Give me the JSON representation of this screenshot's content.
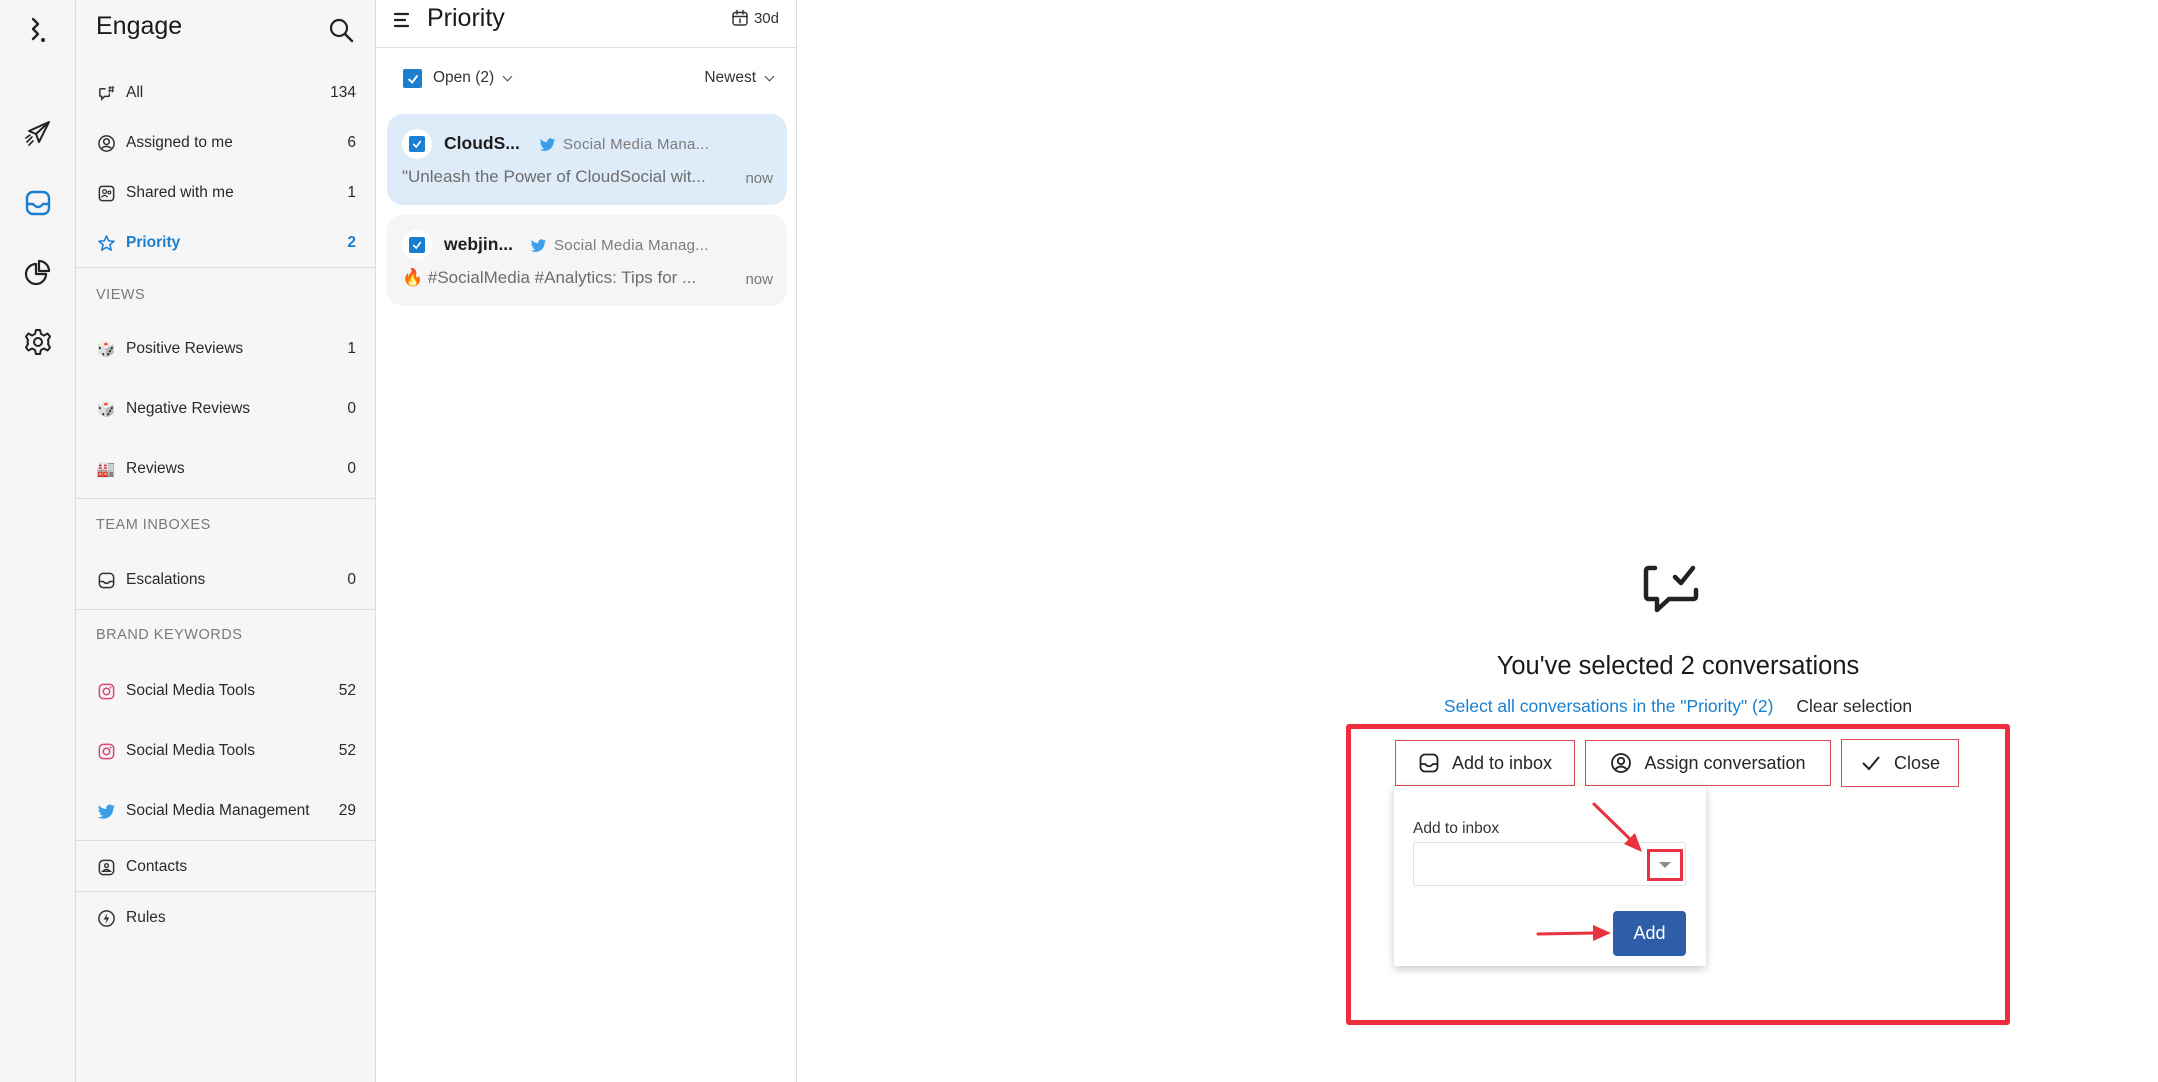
{
  "nav_rail": {
    "items": [
      {
        "name": "logo",
        "icon": "brand-logo-icon"
      },
      {
        "name": "publish",
        "icon": "paper-plane-icon"
      },
      {
        "name": "engage",
        "icon": "inbox-icon",
        "active": true
      },
      {
        "name": "reports",
        "icon": "pie-chart-icon"
      },
      {
        "name": "settings",
        "icon": "gear-icon"
      }
    ]
  },
  "sidebar": {
    "title": "Engage",
    "search_icon": "search-icon",
    "items": [
      {
        "label": "All",
        "count": "134",
        "icon": "chat-hash-icon"
      },
      {
        "label": "Assigned to me",
        "count": "6",
        "icon": "user-circle-icon"
      },
      {
        "label": "Shared with me",
        "count": "1",
        "icon": "shared-users-icon"
      },
      {
        "label": "Priority",
        "count": "2",
        "icon": "star-icon",
        "active": true
      }
    ],
    "views_header": "VIEWS",
    "views": [
      {
        "label": "Positive Reviews",
        "count": "1",
        "icon": "dice-emoji-icon"
      },
      {
        "label": "Negative Reviews",
        "count": "0",
        "icon": "dice-emoji-icon"
      },
      {
        "label": "Reviews",
        "count": "0",
        "icon": "factory-emoji-icon"
      }
    ],
    "team_header": "TEAM INBOXES",
    "team": [
      {
        "label": "Escalations",
        "count": "0",
        "icon": "inbox-icon"
      }
    ],
    "brand_header": "BRAND KEYWORDS",
    "brand": [
      {
        "label": "Social Media Tools",
        "count": "52",
        "icon": "instagram-icon"
      },
      {
        "label": "Social Media Tools",
        "count": "52",
        "icon": "instagram-icon"
      },
      {
        "label": "Social Media Management",
        "count": "29",
        "icon": "twitter-icon"
      }
    ],
    "contacts": "Contacts",
    "rules": "Rules"
  },
  "list": {
    "title": "Priority",
    "date_range": "30d",
    "status_filter": "Open (2)",
    "sort": "Newest",
    "conversations": [
      {
        "author": "CloudS...",
        "source": "Social Media Mana...",
        "preview": "\"Unleash the Power of CloudSocial wit...",
        "time": "now",
        "selected": true,
        "checked": true
      },
      {
        "author": "webjin...",
        "source": "Social Media Manag...",
        "preview": "🔥 #SocialMedia #Analytics: Tips for ...",
        "time": "now",
        "selected": false,
        "checked": true
      }
    ]
  },
  "main": {
    "heading": "You've selected 2 conversations",
    "select_all_link": "Select all conversations in the \"Priority\" (2)",
    "clear_selection": "Clear selection",
    "actions": {
      "add_to_inbox": "Add to inbox",
      "assign": "Assign conversation",
      "close": "Close"
    },
    "popover": {
      "label": "Add to inbox",
      "select_value": "",
      "add_button": "Add"
    }
  },
  "colors": {
    "accent": "#1a7fd0",
    "selected_card": "#deebf8",
    "highlight": "#ee2d3f",
    "primary_button": "#2f5ea8"
  }
}
